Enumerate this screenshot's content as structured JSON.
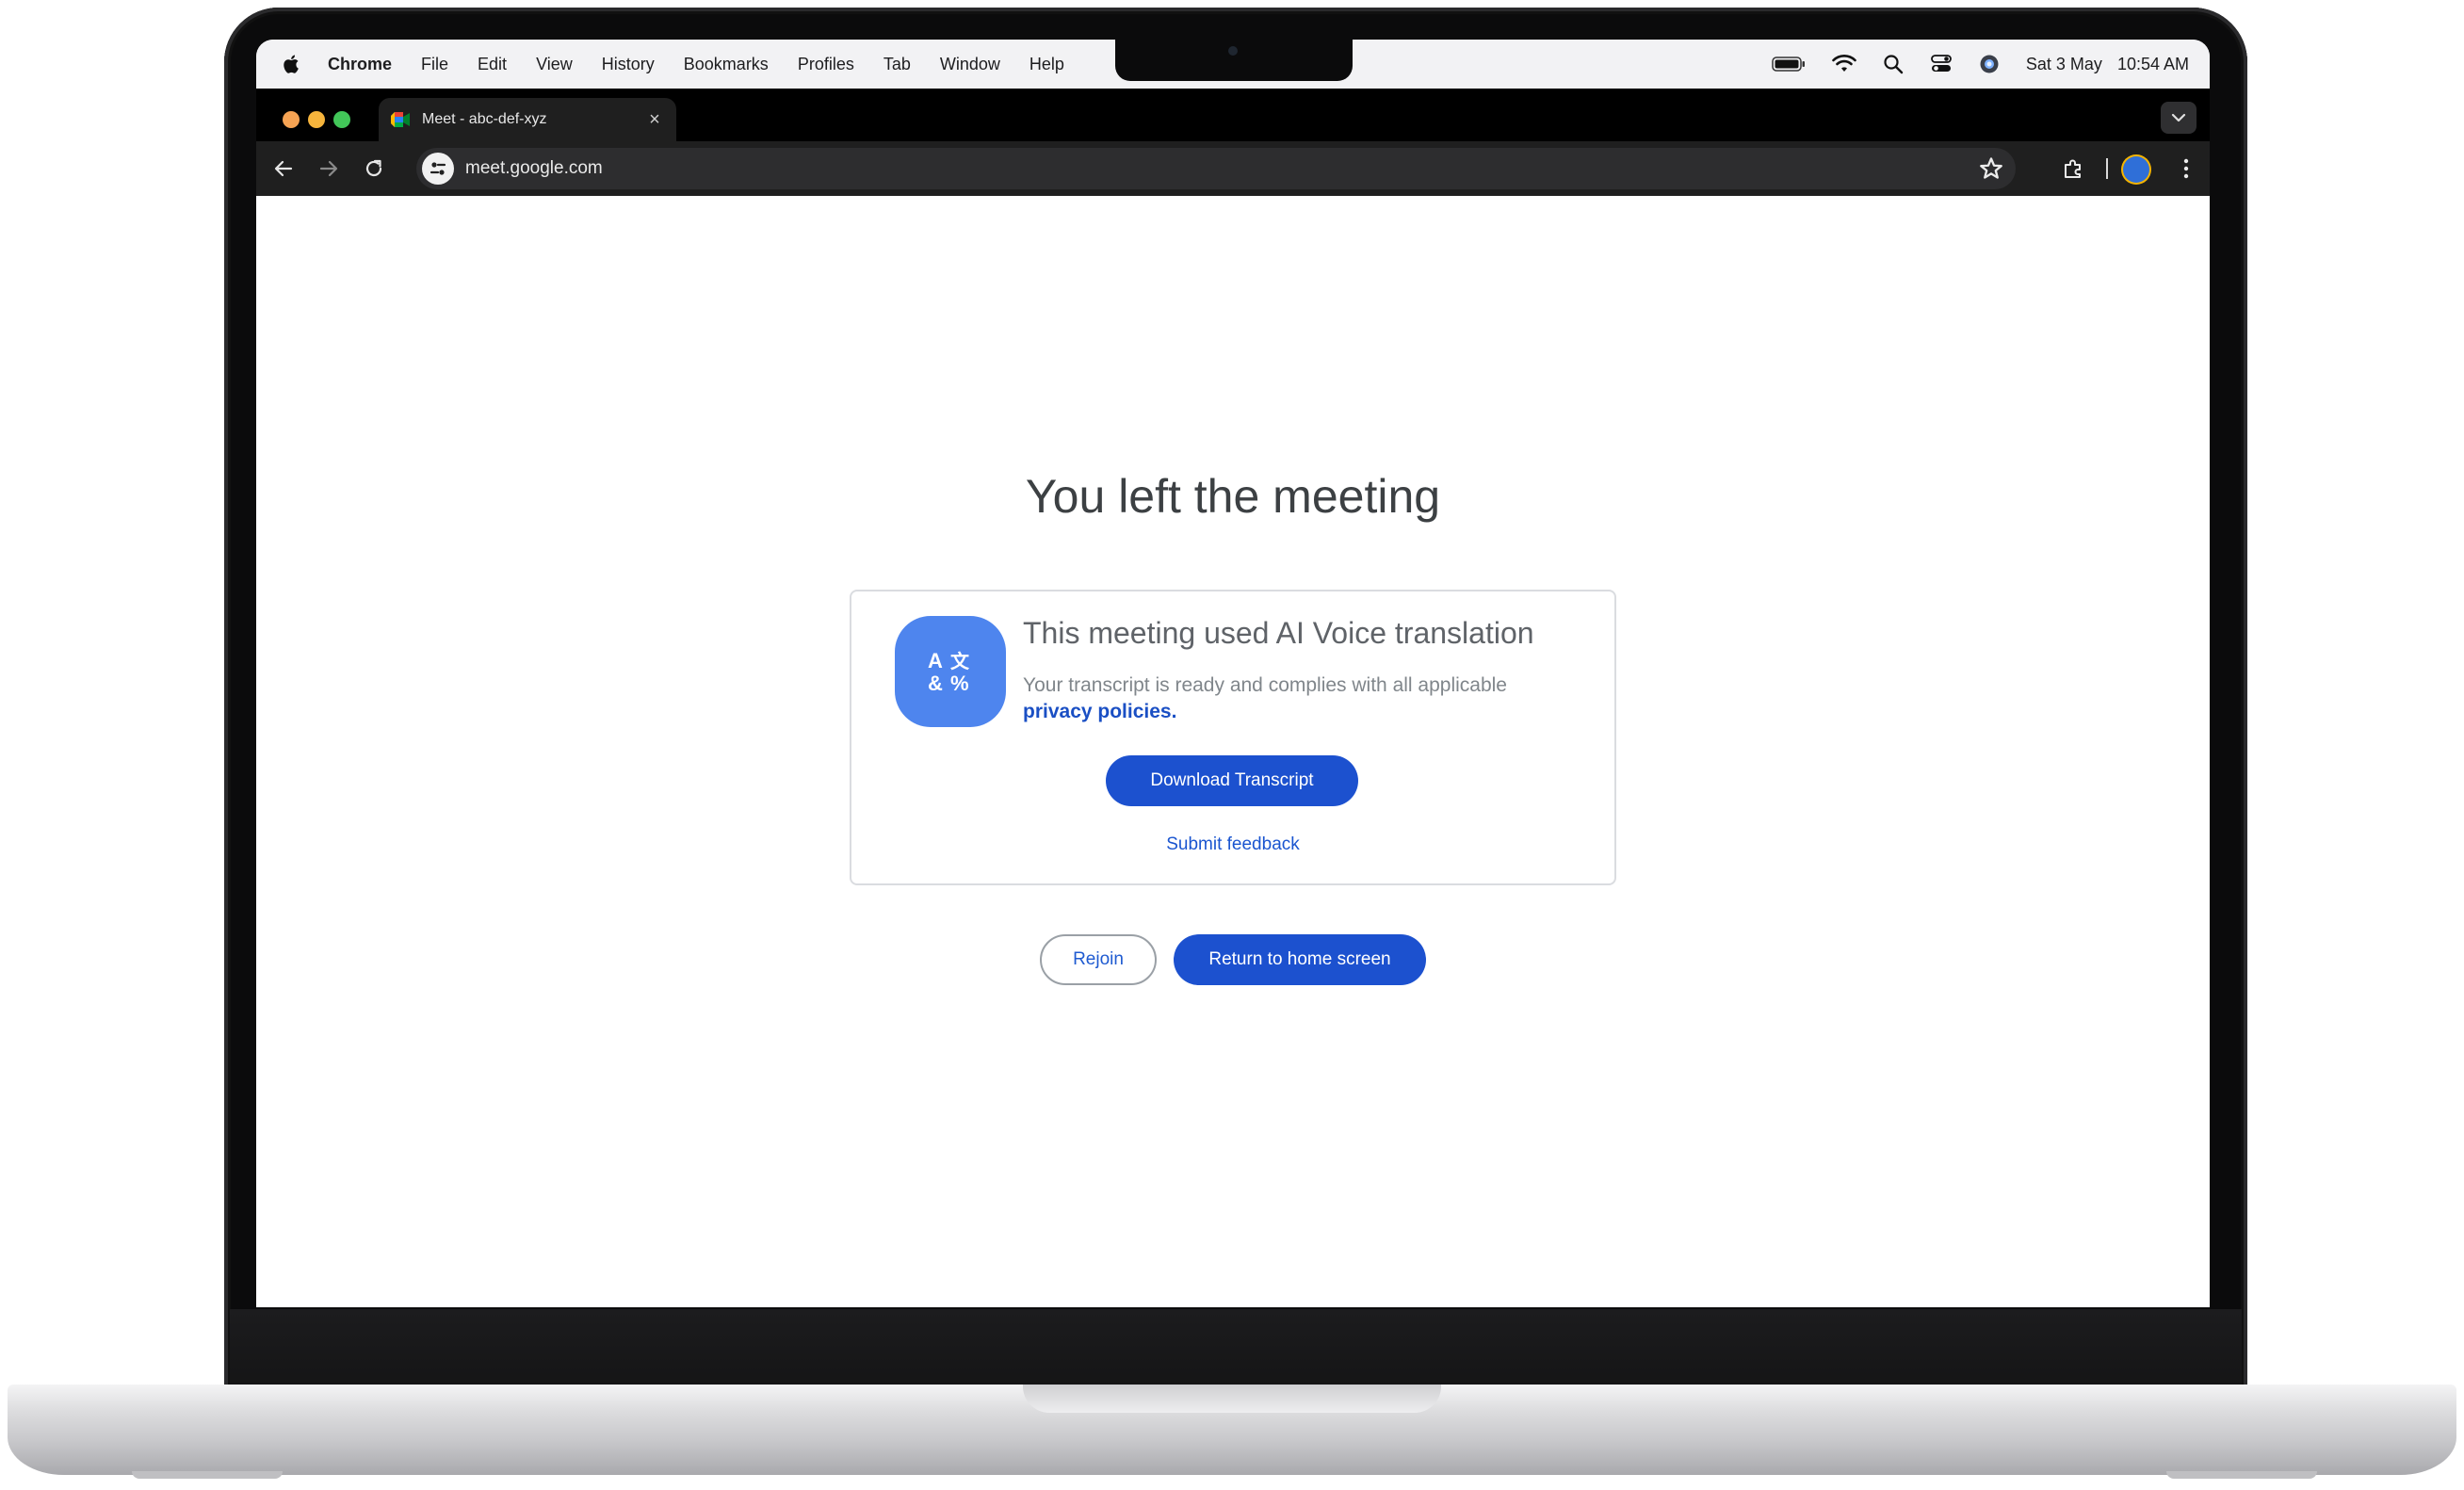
{
  "menubar": {
    "app": "Chrome",
    "items": [
      "File",
      "Edit",
      "View",
      "History",
      "Bookmarks",
      "Profiles",
      "Tab",
      "Window",
      "Help"
    ],
    "date": "Sat 3 May",
    "time": "10:54 AM"
  },
  "browser": {
    "tab_title": "Meet - abc-def-xyz",
    "url": "meet.google.com"
  },
  "page": {
    "title": "You left the meeting",
    "card": {
      "heading": "This meeting used AI Voice translation",
      "text": "Your transcript is ready and complies with all applicable",
      "link": "privacy policies.",
      "download_button": "Download Transcript",
      "feedback_link": "Submit feedback"
    },
    "rejoin_button": "Rejoin",
    "home_button": "Return to home screen"
  },
  "colors": {
    "primary": "#1c51cf",
    "icon_bg": "#4e85ee"
  }
}
